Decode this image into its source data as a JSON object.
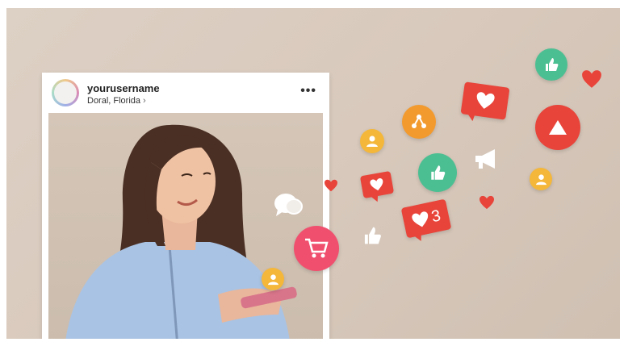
{
  "post": {
    "username": "yourusername",
    "location": "Doral, Florida",
    "location_chevron": "›",
    "more_menu": "•••"
  },
  "notifications": {
    "like_count": "3"
  },
  "colors": {
    "background": "#d8c9bc",
    "red": "#e8443a",
    "orange": "#f29a2e",
    "yellow": "#f4b73a",
    "green": "#4cbf92",
    "pink": "#f0506e",
    "white": "#ffffff"
  },
  "icons": [
    "thumbs-up-icon",
    "heart-icon",
    "share-icon",
    "play-icon",
    "user-icon",
    "megaphone-icon",
    "chat-bubbles-icon",
    "shopping-cart-icon"
  ]
}
